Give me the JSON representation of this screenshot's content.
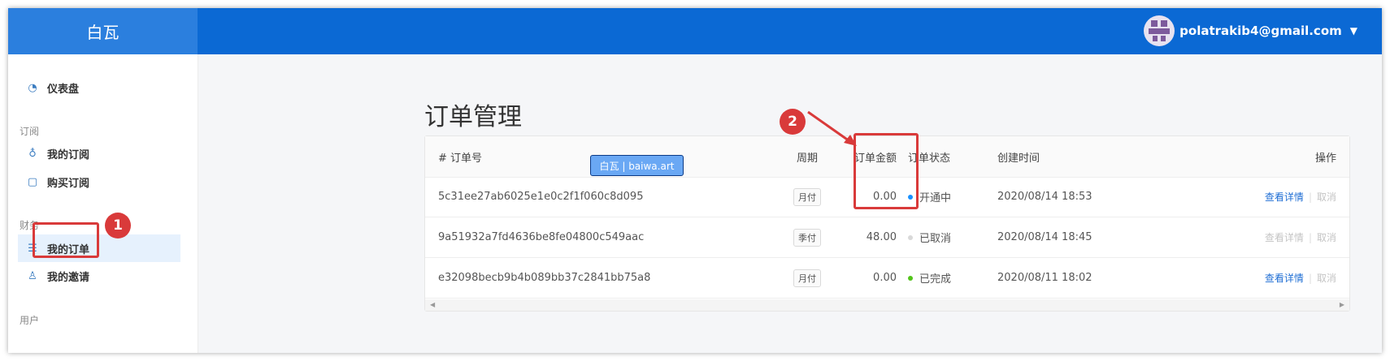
{
  "app": {
    "logo": "白瓦"
  },
  "header": {
    "user_email": "polatrakib4@gmail.com"
  },
  "sidebar": {
    "dashboard": "仪表盘",
    "group_subscription": "订阅",
    "my_subscription": "我的订阅",
    "buy_subscription": "购买订阅",
    "group_finance": "财务",
    "my_orders": "我的订单",
    "my_invites": "我的邀请",
    "group_user": "用户"
  },
  "page": {
    "title": "订单管理"
  },
  "table": {
    "headers": {
      "id": "# 订单号",
      "period": "周期",
      "amount": "订单金额",
      "status": "订单状态",
      "created": "创建时间",
      "ops": "操作"
    },
    "rows": [
      {
        "id": "5c31ee27ab6025e1e0c2f1f060c8d095",
        "period": "月付",
        "amount": "0.00",
        "status": "开通中",
        "status_color": "#1890ff",
        "created": "2020/08/14 18:53",
        "view": "查看详情",
        "cancel": "取消"
      },
      {
        "id": "9a51932a7fd4636be8fe04800c549aac",
        "period": "季付",
        "amount": "48.00",
        "status": "已取消",
        "status_color": "#d9d9d9",
        "created": "2020/08/14 18:45",
        "view": "查看详情",
        "cancel": "取消"
      },
      {
        "id": "e32098becb9b4b089bb37c2841bb75a8",
        "period": "月付",
        "amount": "0.00",
        "status": "已完成",
        "status_color": "#52c41a",
        "created": "2020/08/11 18:02",
        "view": "查看详情",
        "cancel": "取消"
      }
    ]
  },
  "watermark": "白瓦 | baiwa.art",
  "annotations": {
    "step1": "1",
    "step2": "2"
  },
  "colors": {
    "header": "#0b69d4",
    "logo_bg": "#2b7fde",
    "highlight": "#d93a3a",
    "link": "#1f6ed4"
  }
}
